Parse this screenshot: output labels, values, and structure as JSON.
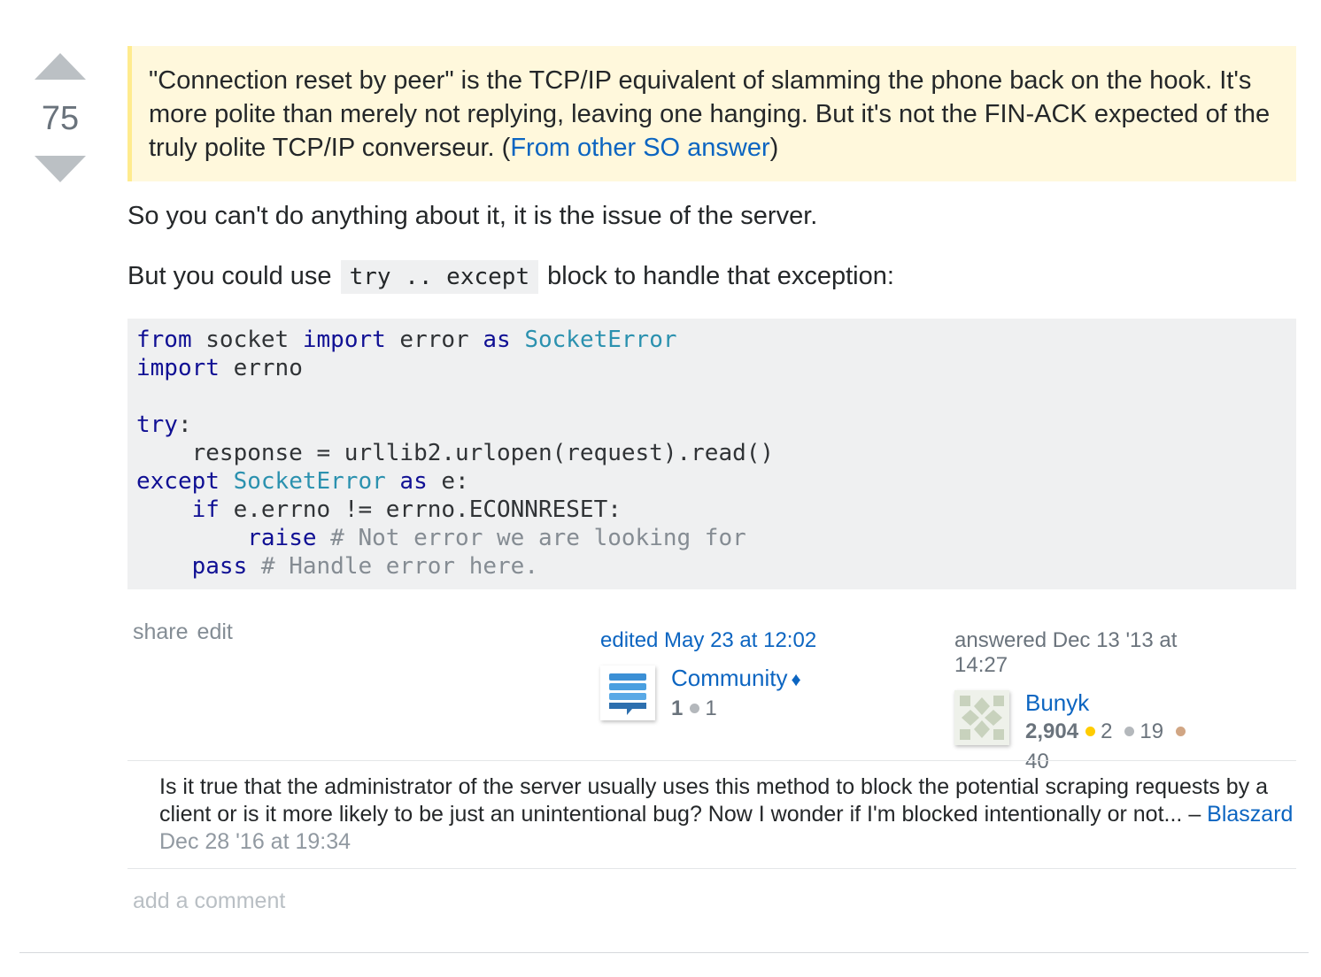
{
  "vote": {
    "count": "75"
  },
  "quote": {
    "text": "\"Connection reset by peer\" is the TCP/IP equivalent of slamming the phone back on the hook. It's more polite than merely not replying, leaving one hanging. But it's not the FIN-ACK expected of the truly polite TCP/IP converseur. (",
    "link": "From other SO answer",
    "tail": ")"
  },
  "body": {
    "p1": "So you can't do anything about it, it is the issue of the server.",
    "p2_before": "But you could use ",
    "p2_code": "try .. except",
    "p2_after": " block to handle that exception:"
  },
  "code": {
    "l1_from": "from",
    "l1_mod": " socket ",
    "l1_import": "import",
    "l1_err": " error ",
    "l1_as": "as",
    "l1_cls": " SocketError",
    "l2_import": "import",
    "l2_rest": " errno",
    "l4_try": "try",
    "l4_colon": ":",
    "l5": "    response = urllib2.urlopen(request).read()",
    "l6_except": "except",
    "l6_cls": " SocketError",
    "l6_as": " as",
    "l6_rest": " e:",
    "l7_indent": "    ",
    "l7_if": "if",
    "l7_rest": " e.errno != errno.ECONNRESET:",
    "l8_indent": "        ",
    "l8_raise": "raise",
    "l8_comment": " # Not error we are looking for",
    "l9_indent": "    ",
    "l9_pass": "pass",
    "l9_comment": " # Handle error here."
  },
  "menu": {
    "share": "share",
    "edit": "edit"
  },
  "edited": {
    "action": "edited May 23 at 12:02",
    "user": "Community",
    "diamond": "♦",
    "rep": "1",
    "badge_count": "1",
    "badge_color": "#b4b8bc"
  },
  "answered": {
    "action": "answered Dec 13 '13 at 14:27",
    "user": "Bunyk",
    "rep": "2,904",
    "gold": "2",
    "silver": "19",
    "bronze": "40",
    "gold_color": "#ffcc01",
    "silver_color": "#b4b8bc",
    "bronze_color": "#d1a684"
  },
  "comment": {
    "text": "Is it true that the administrator of the server usually uses this method to block the potential scraping requests by a client or is it more likely to be just an unintentional bug? Now I wonder if I'm blocked intentionally or not...",
    "dash": " – ",
    "user": "Blaszard",
    "date": "Dec 28 '16 at 19:34"
  },
  "add_comment": "add a comment"
}
